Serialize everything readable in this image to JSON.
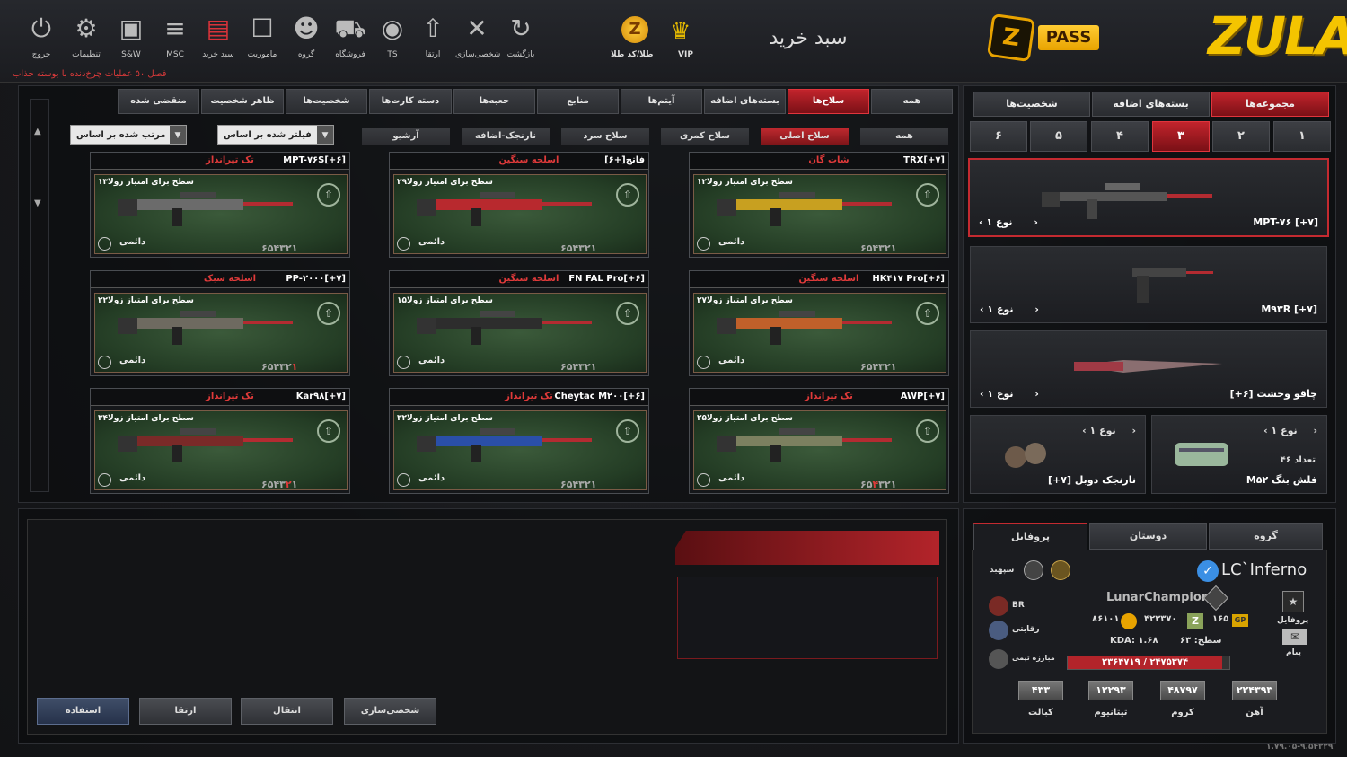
{
  "topbar": {
    "buttons": [
      {
        "label": "خروج",
        "icon": "power-icon"
      },
      {
        "label": "تنظیمات",
        "icon": "gear-icon"
      },
      {
        "label": "S&W",
        "icon": "bag-icon"
      },
      {
        "label": "MSC",
        "icon": "msc-icon"
      },
      {
        "label": "سبد خرید",
        "icon": "cart-case-icon"
      },
      {
        "label": "ماموریت",
        "icon": "clipboard-icon"
      },
      {
        "label": "گروه",
        "icon": "group-icon"
      },
      {
        "label": "فروشگاه",
        "icon": "shop-cart-icon"
      },
      {
        "label": "TS",
        "icon": "ts-icon"
      },
      {
        "label": "ارتقا",
        "icon": "upgrade-icon"
      },
      {
        "label": "شخصی‌سازی",
        "icon": "tools-icon"
      },
      {
        "label": "بازگشت",
        "icon": "back-icon"
      }
    ],
    "gold_label": "طلا/کد طلا",
    "vip_label": "VIP",
    "title": "سبد خرید",
    "pass_label": "PASS",
    "logo": "ZULA",
    "ticker": "فصل ۵۰ عملیات چرخ‌دنده با بوسته جذاب"
  },
  "categories": [
    "همه",
    "سلاح‌ها",
    "بسته‌های اضافه",
    "آیتم‌ها",
    "منابع",
    "جعبه‌ها",
    "دسته کارت‌ها",
    "شخصیت‌ها",
    "ظاهر شخصیت",
    "منقضی شده"
  ],
  "subcategories": [
    "همه",
    "سلاح اصلی",
    "سلاح کمری",
    "سلاح سرد",
    "نارنجک‌-اضافه",
    "آرشیو"
  ],
  "filter_dd": "فیلتر شده بر اساس",
  "sort_dd": "مرتب شده بر اساس",
  "cards": [
    {
      "name": "TRX[+۷]",
      "cat": "شات گان",
      "desc": "سطح برای امتیاز زولا۱۲",
      "perm": "دائمی",
      "levels": "۱۲۳۴۵۶",
      "hl": ""
    },
    {
      "name": "فاتح[+۶]",
      "cat": "اسلحه سنگین",
      "desc": "سطح برای امتیاز زولا۲۹",
      "perm": "دائمی",
      "levels": "۱۲۳۴۵۶",
      "hl": ""
    },
    {
      "name": "MPT-۷۶S[+۶]",
      "cat": "تک تیرانداز",
      "desc": "سطح برای امتیاز زولا۱۳",
      "perm": "دائمی",
      "levels": "۱۲۳۴۵۶",
      "hl": ""
    },
    {
      "name": "HK۴۱۷ Pro[+۶]",
      "cat": "اسلحه سنگین",
      "desc": "سطح برای امتیاز زولا۲۷",
      "perm": "دائمی",
      "levels": "۱۲۳۴۵۶",
      "hl": ""
    },
    {
      "name": "FN FAL Pro[+۶]",
      "cat": "اسلحه سنگین",
      "desc": "سطح برای امتیاز زولا۱۵",
      "perm": "دائمی",
      "levels": "۱۲۳۴۵۶",
      "hl": ""
    },
    {
      "name": "PP-۲۰۰۰[+۷]",
      "cat": "اسلحه سبک",
      "desc": "سطح برای امتیاز زولا۲۲",
      "perm": "دائمی",
      "levels": "۱۲۳۴۵۶",
      "hl": "۱"
    },
    {
      "name": "AWP[+۷]",
      "cat": "تک تیرانداز",
      "desc": "سطح برای امتیاز زولا۲۵",
      "perm": "دائمی",
      "levels": "۱۲۳۴۵۶",
      "hl": "۴"
    },
    {
      "name": "Cheytac M۲۰۰[+۶]",
      "cat": "تک تیرانداز",
      "desc": "سطح برای امتیاز زولا۳۲",
      "perm": "دائمی",
      "levels": "۱۲۳۴۵۶",
      "hl": ""
    },
    {
      "name": "Kar۹۸[+۷]",
      "cat": "تک تیرانداز",
      "desc": "سطح برای امتیاز زولا۳۴",
      "perm": "دائمی",
      "levels": "۱۲۳۴۵۶",
      "hl": "۲"
    }
  ],
  "bottom_buttons": [
    "شخصی‌سازی",
    "انتقال",
    "ارتقا",
    "استفاده"
  ],
  "right": {
    "tabs": [
      "مجموعه‌ها",
      "بسته‌های اضافه",
      "شخصیت‌ها"
    ],
    "nums": [
      "۱",
      "۲",
      "۳",
      "۴",
      "۵",
      "۶"
    ],
    "slots": [
      {
        "name": "MPT-۷۶ [+۷]",
        "type": "نوع ۱"
      },
      {
        "name": "M۹۳R [+۷]",
        "type": "نوع ۱"
      },
      {
        "name": "[+۶] چاقو وحشت",
        "type": "نوع ۱"
      },
      {
        "name": "M۵۲ فلش بنگ",
        "type": "نوع ۱",
        "count": "تعداد ۴۶"
      },
      {
        "name": "[+۷] نارنجک دوبل",
        "type": "نوع ۱"
      }
    ]
  },
  "profile": {
    "tabs": [
      "گروه",
      "دوستان",
      "پروفایل"
    ],
    "username": "LC`Inferno",
    "clan": "LunarChampion",
    "rank": "سپهبد",
    "gp": "۱۶۵",
    "zp": "۴۲۲۳۷۰",
    "gold": "۸۶۱۰۱",
    "level": "سطح: ۶۳",
    "kda": "KDA: ۱.۶۸",
    "xp": "۲۳۶۴۷۱۹ / ۲۴۷۵۳۷۴",
    "br": "BR",
    "rivalry": "رقابتی",
    "team": "مبارزه تیمی",
    "side_profile": "پروفایل",
    "side_msg": "پیام",
    "stats": [
      {
        "label": "آهن",
        "value": "۲۲۴۳۹۳"
      },
      {
        "label": "کروم",
        "value": "۴۸۷۹۷"
      },
      {
        "label": "تیتانیوم",
        "value": "۱۲۲۹۳"
      },
      {
        "label": "کبالت",
        "value": "۴۳۳"
      }
    ],
    "version": "۱.۷۹.۰۵-۹.۵۴۲۲۹"
  }
}
